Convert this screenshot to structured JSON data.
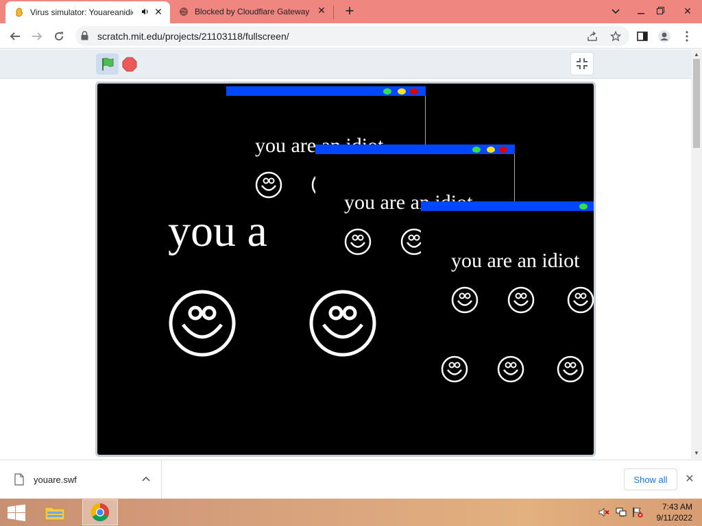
{
  "browser": {
    "tabs": [
      {
        "title": "Virus simulator: Youareanidio",
        "active": true,
        "audio": true
      },
      {
        "title": "Blocked by Cloudflare Gateway",
        "active": false
      }
    ],
    "new_tab": "+",
    "url": "scratch.mit.edu/projects/21103118/fullscreen/"
  },
  "player": {
    "accent": "#0047ff",
    "popups": [
      {
        "text": "you are an idiot"
      },
      {
        "text": "you are an idiot"
      },
      {
        "text": "you are an idiot"
      }
    ],
    "big_text": "you a"
  },
  "downloads": {
    "file_name": "youare.swf",
    "show_all": "Show all"
  },
  "taskbar": {
    "time": "7:43 AM",
    "date": "9/11/2022"
  }
}
